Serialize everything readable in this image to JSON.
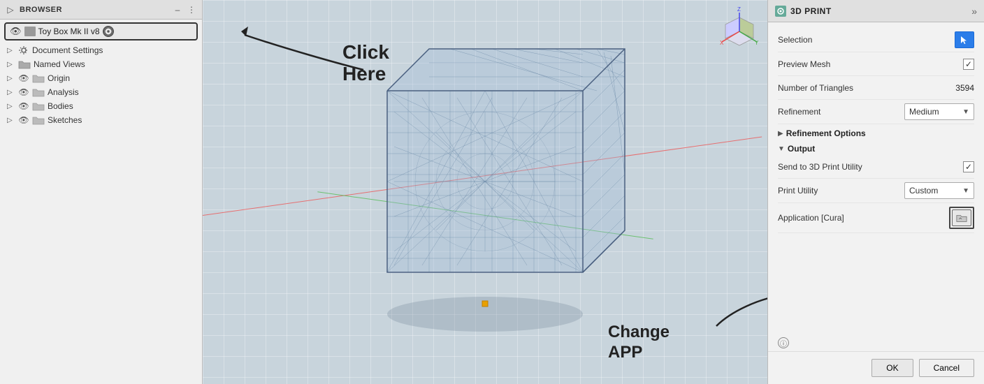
{
  "browser": {
    "title": "BROWSER",
    "document": {
      "name": "Toy Box Mk II v8",
      "icon": "document-icon",
      "eye_icon": "👁"
    },
    "items": [
      {
        "label": "Document Settings",
        "has_eye": false
      },
      {
        "label": "Named Views",
        "has_eye": false
      },
      {
        "label": "Origin",
        "has_eye": true
      },
      {
        "label": "Analysis",
        "has_eye": true
      },
      {
        "label": "Bodies",
        "has_eye": true
      },
      {
        "label": "Sketches",
        "has_eye": true
      }
    ]
  },
  "annotation": {
    "click_here": "Click\nHere",
    "change_app": "Change\nAPP"
  },
  "print_panel": {
    "title": "3D PRINT",
    "fields": {
      "selection_label": "Selection",
      "preview_mesh_label": "Preview Mesh",
      "num_triangles_label": "Number of Triangles",
      "num_triangles_value": "3594",
      "refinement_label": "Refinement",
      "refinement_value": "Medium",
      "refinement_options_label": "Refinement Options"
    },
    "output": {
      "section_label": "Output",
      "send_label": "Send to 3D Print Utility",
      "print_utility_label": "Print Utility",
      "print_utility_value": "Custom",
      "application_label": "Application [Cura]"
    },
    "buttons": {
      "ok": "OK",
      "cancel": "Cancel"
    }
  }
}
